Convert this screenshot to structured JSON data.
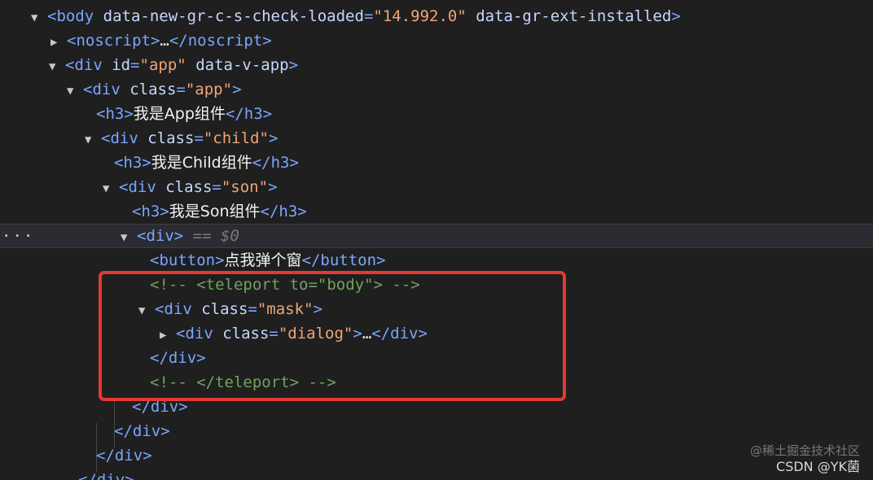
{
  "dom_tree": {
    "body_open": {
      "tag_open": "<body",
      "attr1_name": " data-new-gr-c-s-check-loaded",
      "attr1_eq": "=",
      "attr1_value": "\"14.992.0\"",
      "attr2_name": " data-gr-ext-installed",
      "tag_close": ">"
    },
    "noscript": {
      "open": "<noscript>",
      "ellipsis": "…",
      "close": "</noscript>"
    },
    "div_app_root": {
      "tag_open": "<div",
      "attr1_name": " id",
      "attr1_eq": "=",
      "attr1_value": "\"app\"",
      "attr2_name": " data-v-app",
      "tag_close": ">"
    },
    "div_app": {
      "tag_open": "<div",
      "attr_name": " class",
      "attr_eq": "=",
      "attr_value": "\"app\"",
      "tag_close": ">"
    },
    "h3_app": {
      "open": "<h3>",
      "text": "我是App组件",
      "close": "</h3>"
    },
    "div_child": {
      "tag_open": "<div",
      "attr_name": " class",
      "attr_eq": "=",
      "attr_value": "\"child\"",
      "tag_close": ">"
    },
    "h3_child": {
      "open": "<h3>",
      "text": "我是Child组件",
      "close": "</h3>"
    },
    "div_son": {
      "tag_open": "<div",
      "attr_name": " class",
      "attr_eq": "=",
      "attr_value": "\"son\"",
      "tag_close": ">"
    },
    "h3_son": {
      "open": "<h3>",
      "text": "我是Son组件",
      "close": "</h3>"
    },
    "div_selected": {
      "dots": "···",
      "open": "<div>",
      "marker": " == $0"
    },
    "button": {
      "open": "<button>",
      "text": "点我弹个窗",
      "close": "</button>"
    },
    "comment_teleport_open": "<!-- <teleport to=\"body\"> -->",
    "div_mask": {
      "tag_open": "<div",
      "attr_name": " class",
      "attr_eq": "=",
      "attr_value": "\"mask\"",
      "tag_close": ">"
    },
    "div_dialog": {
      "tag_open": "<div",
      "attr_name": " class",
      "attr_eq": "=",
      "attr_value": "\"dialog\"",
      "tag_close": ">",
      "ellipsis": "…",
      "close": "</div>"
    },
    "close_div_mask": "</div>",
    "comment_teleport_close": "<!-- </teleport> -->",
    "close_div_selected": "</div>",
    "close_div_son": "</div>",
    "close_div_child": "</div>",
    "close_div_app": "</div>"
  },
  "watermark": {
    "line1": "@稀土掘金技术社区",
    "line2": "CSDN @YK菌"
  },
  "colors": {
    "background": "#1f1f1f",
    "tag": "#7aa6ff",
    "attr_name": "#c5d7ff",
    "attr_value": "#f0a576",
    "comment": "#6fa35e",
    "highlight_border": "#e53935",
    "selected_row": "#2a2c31"
  }
}
